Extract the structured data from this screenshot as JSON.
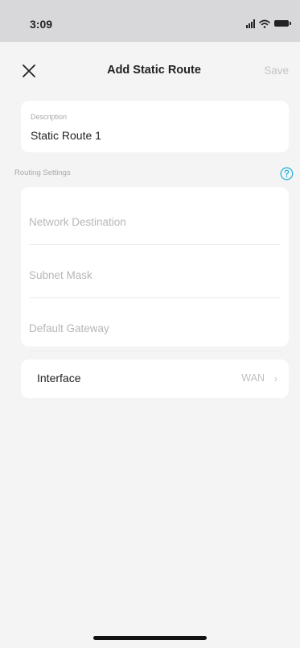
{
  "status_bar": {
    "time": "3:09",
    "icons": [
      "signal-icon",
      "wifi-icon",
      "battery-icon"
    ]
  },
  "nav": {
    "title": "Add Static Route",
    "save_label": "Save",
    "close_icon": "close-icon"
  },
  "description": {
    "label": "Description",
    "value": "Static Route 1"
  },
  "routing_settings": {
    "title": "Routing Settings",
    "help_icon": "help-icon",
    "fields": [
      {
        "placeholder": "Network Destination",
        "value": ""
      },
      {
        "placeholder": "Subnet Mask",
        "value": ""
      },
      {
        "placeholder": "Default Gateway",
        "value": ""
      }
    ]
  },
  "interface": {
    "label": "Interface",
    "value": "WAN",
    "chevron": "›"
  },
  "colors": {
    "accent": "#2fb5d8",
    "background": "#f4f4f5",
    "card": "#ffffff",
    "placeholder": "#b7b7bb"
  }
}
